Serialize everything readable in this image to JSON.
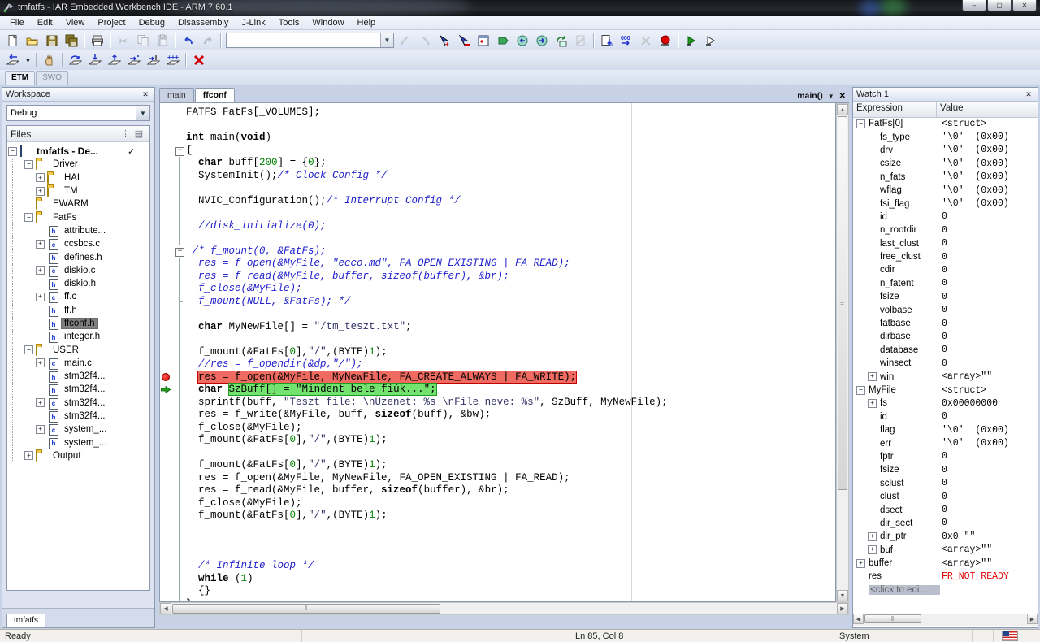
{
  "colors": {
    "breakpoint_red": "#d40000",
    "exec_green": "#74e26e",
    "bp_line_red": "#ef6a60",
    "error_red": "#e00000",
    "selection_gray": "#7f7f7f"
  },
  "window": {
    "title": "tmfatfs - IAR Embedded Workbench IDE - ARM 7.60.1",
    "minimize": "–",
    "maximize": "▢",
    "close": "✕"
  },
  "menubar": {
    "items": [
      "File",
      "Edit",
      "View",
      "Project",
      "Debug",
      "Disassembly",
      "J-Link",
      "Tools",
      "Window",
      "Help"
    ]
  },
  "toolbar_main": {
    "search_value": "",
    "buttons": [
      "new-file",
      "open-file",
      "save",
      "save-all",
      "sep",
      "print",
      "sep",
      "cut|d",
      "copy|d",
      "paste|d",
      "sep",
      "undo",
      "redo|d",
      "sep",
      "combo",
      "find-prev|d",
      "find-next|d",
      "toggle-breakpoint",
      "enable-breakpoint",
      "breakpoints-window",
      "bookmark-flag",
      "navigate-back",
      "navigate-forward",
      "refresh",
      "stop-build|d",
      "sep",
      "download-and-debug",
      "debug-without-downloading",
      "power-debug|d",
      "attach-to-running",
      "sep",
      "make-and-restart",
      "compile-and-run"
    ]
  },
  "toolbar_debug": {
    "buttons": [
      "reset",
      "caret",
      "sep",
      "break",
      "sep",
      "step-over",
      "step-into",
      "step-out",
      "next-statement",
      "run-to-cursor",
      "go",
      "sep",
      "stop-debugging"
    ]
  },
  "trace_tabs": {
    "items": [
      {
        "label": "ETM",
        "active": true
      },
      {
        "label": "SWO",
        "active": false
      }
    ]
  },
  "workspace": {
    "title": "Workspace",
    "close": "✕",
    "config": "Debug",
    "files_header": "Files",
    "bottom_tab": "tmfatfs",
    "header_icons": [
      "sort-icon",
      "file-order-icon"
    ],
    "tree": [
      [
        0,
        "-",
        "prj",
        "tmfatfs - De...",
        "root"
      ],
      [
        1,
        "-",
        "fld",
        "Driver",
        ""
      ],
      [
        2,
        "+",
        "fld",
        "HAL",
        ""
      ],
      [
        2,
        "+",
        "fld",
        "TM",
        ""
      ],
      [
        1,
        "",
        "fld",
        "EWARM",
        ""
      ],
      [
        1,
        "-",
        "fld",
        "FatFs",
        ""
      ],
      [
        2,
        "",
        "h",
        "attribute...",
        ""
      ],
      [
        2,
        "+",
        "c",
        "ccsbcs.c",
        ""
      ],
      [
        2,
        "",
        "h",
        "defines.h",
        ""
      ],
      [
        2,
        "+",
        "c",
        "diskio.c",
        ""
      ],
      [
        2,
        "",
        "h",
        "diskio.h",
        ""
      ],
      [
        2,
        "+",
        "c",
        "ff.c",
        ""
      ],
      [
        2,
        "",
        "h",
        "ff.h",
        ""
      ],
      [
        2,
        "",
        "h",
        "ffconf.h",
        "sel"
      ],
      [
        2,
        "",
        "h",
        "integer.h",
        ""
      ],
      [
        1,
        "-",
        "fld",
        "USER",
        ""
      ],
      [
        2,
        "+",
        "c",
        "main.c",
        ""
      ],
      [
        2,
        "",
        "h",
        "stm32f4...",
        ""
      ],
      [
        2,
        "",
        "h",
        "stm32f4...",
        ""
      ],
      [
        2,
        "+",
        "c",
        "stm32f4...",
        ""
      ],
      [
        2,
        "",
        "h",
        "stm32f4...",
        ""
      ],
      [
        2,
        "+",
        "c",
        "system_...",
        ""
      ],
      [
        2,
        "",
        "h",
        "system_...",
        ""
      ],
      [
        1,
        "+",
        "fld",
        "Output",
        ""
      ]
    ]
  },
  "editor": {
    "tabs": [
      {
        "label": "main",
        "active": false
      },
      {
        "label": "ffconf",
        "active": true
      }
    ],
    "function_selector": "main()",
    "close": "✕",
    "code_lines": [
      {
        "f": "",
        "g": "",
        "s": [
          [
            "FATFS FatFs[_VOLUMES];",
            "t"
          ]
        ]
      },
      {
        "f": "",
        "g": "",
        "s": []
      },
      {
        "f": "",
        "g": "",
        "s": [
          [
            "int",
            "k"
          ],
          [
            " main(",
            "t"
          ],
          [
            "void",
            "k"
          ],
          [
            ")",
            "t"
          ]
        ]
      },
      {
        "f": "m",
        "g": "",
        "s": [
          [
            "{",
            "t"
          ]
        ]
      },
      {
        "f": "l",
        "g": "",
        "s": [
          [
            "  ",
            "t"
          ],
          [
            "char",
            "k"
          ],
          [
            " buff[",
            "t"
          ],
          [
            "200",
            "n"
          ],
          [
            "] = {",
            "t"
          ],
          [
            "0",
            "n"
          ],
          [
            "};",
            "t"
          ]
        ]
      },
      {
        "f": "l",
        "g": "",
        "s": [
          [
            "  SystemInit();",
            "t"
          ],
          [
            "/* Clock Config */",
            "c"
          ]
        ]
      },
      {
        "f": "l",
        "g": "",
        "s": []
      },
      {
        "f": "l",
        "g": "",
        "s": [
          [
            "  NVIC_Configuration();",
            "t"
          ],
          [
            "/* Interrupt Config */",
            "c"
          ]
        ]
      },
      {
        "f": "l",
        "g": "",
        "s": []
      },
      {
        "f": "l",
        "g": "",
        "s": [
          [
            "  ",
            "t"
          ],
          [
            "//disk_initialize(0);",
            "c"
          ]
        ]
      },
      {
        "f": "l",
        "g": "",
        "s": []
      },
      {
        "f": "m",
        "g": "",
        "s": [
          [
            " /* f_mount(0, &FatFs);",
            "c"
          ]
        ]
      },
      {
        "f": "l",
        "g": "",
        "s": [
          [
            "  res = f_open(&MyFile, \"ecco.md\", FA_OPEN_EXISTING | FA_READ);",
            "c"
          ]
        ]
      },
      {
        "f": "l",
        "g": "",
        "s": [
          [
            "  res = f_read(&MyFile, buffer, sizeof(buffer), &br);",
            "c"
          ]
        ]
      },
      {
        "f": "l",
        "g": "",
        "s": [
          [
            "  f_close(&MyFile);",
            "c"
          ]
        ]
      },
      {
        "f": "t",
        "g": "",
        "s": [
          [
            "  f_mount(NULL, &FatFs); */",
            "c"
          ]
        ]
      },
      {
        "f": "l",
        "g": "",
        "s": []
      },
      {
        "f": "l",
        "g": "",
        "s": [
          [
            "  ",
            "t"
          ],
          [
            "char",
            "k"
          ],
          [
            " MyNewFile[] = ",
            "t"
          ],
          [
            "\"/tm_teszt.txt\"",
            "s"
          ],
          [
            ";",
            "t"
          ]
        ]
      },
      {
        "f": "l",
        "g": "",
        "s": []
      },
      {
        "f": "l",
        "g": "",
        "s": [
          [
            "  f_mount(&FatFs[",
            "t"
          ],
          [
            "0",
            "n"
          ],
          [
            "],",
            "t"
          ],
          [
            "\"/\"",
            "s"
          ],
          [
            ",(BYTE)",
            "t"
          ],
          [
            "1",
            "n"
          ],
          [
            ");",
            "t"
          ]
        ]
      },
      {
        "f": "l",
        "g": "",
        "s": [
          [
            "  ",
            "t"
          ],
          [
            "//res = f_opendir(&dp,\"/\");",
            "c"
          ]
        ]
      },
      {
        "f": "l",
        "g": "bp",
        "s": [
          [
            "  ",
            "t"
          ],
          [
            "res = f_open(&MyFile, MyNewFile, FA_CREATE_ALWAYS | FA_WRITE);",
            "t",
            "r"
          ]
        ]
      },
      {
        "f": "l",
        "g": "pc",
        "s": [
          [
            "  ",
            "t"
          ],
          [
            "char",
            "k"
          ],
          [
            " ",
            "t"
          ],
          [
            "SzBuff[] = \"Mindent bele fiúk...\";",
            "t",
            "g"
          ]
        ]
      },
      {
        "f": "l",
        "g": "",
        "s": [
          [
            "  sprintf(buff, ",
            "t"
          ],
          [
            "\"Teszt file: \\nÜzenet: %s \\nFile neve: %s\"",
            "s"
          ],
          [
            ", SzBuff, MyNewFile);",
            "t"
          ]
        ]
      },
      {
        "f": "l",
        "g": "",
        "s": [
          [
            "  res = f_write(&MyFile, buff, ",
            "t"
          ],
          [
            "sizeof",
            "k"
          ],
          [
            "(buff), &bw);",
            "t"
          ]
        ]
      },
      {
        "f": "l",
        "g": "",
        "s": [
          [
            "  f_close(&MyFile);",
            "t"
          ]
        ]
      },
      {
        "f": "l",
        "g": "",
        "s": [
          [
            "  f_mount(&FatFs[",
            "t"
          ],
          [
            "0",
            "n"
          ],
          [
            "],",
            "t"
          ],
          [
            "\"/\"",
            "s"
          ],
          [
            ",(BYTE)",
            "t"
          ],
          [
            "1",
            "n"
          ],
          [
            ");",
            "t"
          ]
        ]
      },
      {
        "f": "l",
        "g": "",
        "s": []
      },
      {
        "f": "l",
        "g": "",
        "s": [
          [
            "  f_mount(&FatFs[",
            "t"
          ],
          [
            "0",
            "n"
          ],
          [
            "],",
            "t"
          ],
          [
            "\"/\"",
            "s"
          ],
          [
            ",(BYTE)",
            "t"
          ],
          [
            "1",
            "n"
          ],
          [
            ");",
            "t"
          ]
        ]
      },
      {
        "f": "l",
        "g": "",
        "s": [
          [
            "  res = f_open(&MyFile, MyNewFile, FA_OPEN_EXISTING | FA_READ);",
            "t"
          ]
        ]
      },
      {
        "f": "l",
        "g": "",
        "s": [
          [
            "  res = f_read(&MyFile, buffer, ",
            "t"
          ],
          [
            "sizeof",
            "k"
          ],
          [
            "(buffer), &br);",
            "t"
          ]
        ]
      },
      {
        "f": "l",
        "g": "",
        "s": [
          [
            "  f_close(&MyFile);",
            "t"
          ]
        ]
      },
      {
        "f": "l",
        "g": "",
        "s": [
          [
            "  f_mount(&FatFs[",
            "t"
          ],
          [
            "0",
            "n"
          ],
          [
            "],",
            "t"
          ],
          [
            "\"/\"",
            "s"
          ],
          [
            ",(BYTE)",
            "t"
          ],
          [
            "1",
            "n"
          ],
          [
            ");",
            "t"
          ]
        ]
      },
      {
        "f": "l",
        "g": "",
        "s": []
      },
      {
        "f": "l",
        "g": "",
        "s": []
      },
      {
        "f": "l",
        "g": "",
        "s": []
      },
      {
        "f": "l",
        "g": "",
        "s": [
          [
            "  ",
            "t"
          ],
          [
            "/* Infinite loop */",
            "c"
          ]
        ]
      },
      {
        "f": "l",
        "g": "",
        "s": [
          [
            "  ",
            "t"
          ],
          [
            "while",
            "k"
          ],
          [
            " (",
            "t"
          ],
          [
            "1",
            "n"
          ],
          [
            ")",
            "t"
          ]
        ]
      },
      {
        "f": "l",
        "g": "",
        "s": [
          [
            "  {}",
            "t"
          ]
        ]
      },
      {
        "f": "e",
        "g": "",
        "s": [
          [
            "}",
            "t"
          ]
        ]
      }
    ]
  },
  "watch": {
    "title": "Watch 1",
    "close": "✕",
    "columns": [
      "Expression",
      "Value"
    ],
    "rows": [
      [
        0,
        "-",
        "FatFs[0]",
        "<struct>",
        ""
      ],
      [
        1,
        "",
        "fs_type",
        "'\\0'  (0x00)",
        ""
      ],
      [
        1,
        "",
        "drv",
        "'\\0'  (0x00)",
        ""
      ],
      [
        1,
        "",
        "csize",
        "'\\0'  (0x00)",
        ""
      ],
      [
        1,
        "",
        "n_fats",
        "'\\0'  (0x00)",
        ""
      ],
      [
        1,
        "",
        "wflag",
        "'\\0'  (0x00)",
        ""
      ],
      [
        1,
        "",
        "fsi_flag",
        "'\\0'  (0x00)",
        ""
      ],
      [
        1,
        "",
        "id",
        "0",
        ""
      ],
      [
        1,
        "",
        "n_rootdir",
        "0",
        ""
      ],
      [
        1,
        "",
        "last_clust",
        "0",
        ""
      ],
      [
        1,
        "",
        "free_clust",
        "0",
        ""
      ],
      [
        1,
        "",
        "cdir",
        "0",
        ""
      ],
      [
        1,
        "",
        "n_fatent",
        "0",
        ""
      ],
      [
        1,
        "",
        "fsize",
        "0",
        ""
      ],
      [
        1,
        "",
        "volbase",
        "0",
        ""
      ],
      [
        1,
        "",
        "fatbase",
        "0",
        ""
      ],
      [
        1,
        "",
        "dirbase",
        "0",
        ""
      ],
      [
        1,
        "",
        "database",
        "0",
        ""
      ],
      [
        1,
        "",
        "winsect",
        "0",
        ""
      ],
      [
        1,
        "+",
        "win",
        "<array>\"\"",
        ""
      ],
      [
        0,
        "-",
        "MyFile",
        "<struct>",
        ""
      ],
      [
        1,
        "+",
        "fs",
        "0x00000000",
        ""
      ],
      [
        1,
        "",
        "id",
        "0",
        ""
      ],
      [
        1,
        "",
        "flag",
        "'\\0'  (0x00)",
        ""
      ],
      [
        1,
        "",
        "err",
        "'\\0'  (0x00)",
        ""
      ],
      [
        1,
        "",
        "fptr",
        "0",
        ""
      ],
      [
        1,
        "",
        "fsize",
        "0",
        ""
      ],
      [
        1,
        "",
        "sclust",
        "0",
        ""
      ],
      [
        1,
        "",
        "clust",
        "0",
        ""
      ],
      [
        1,
        "",
        "dsect",
        "0",
        ""
      ],
      [
        1,
        "",
        "dir_sect",
        "0",
        ""
      ],
      [
        1,
        "+",
        "dir_ptr",
        "0x0 \"\"",
        ""
      ],
      [
        1,
        "+",
        "buf",
        "<array>\"\"",
        ""
      ],
      [
        0,
        "+",
        "buffer",
        "<array>\"\"",
        ""
      ],
      [
        0,
        "",
        "res",
        "FR_NOT_READY",
        "err"
      ],
      [
        0,
        "",
        "<click to edi...",
        "",
        "ph"
      ]
    ]
  },
  "statusbar": {
    "ready": "Ready",
    "position": "Ln 85, Col 8",
    "mode": "System",
    "flag": "us-flag-icon"
  }
}
